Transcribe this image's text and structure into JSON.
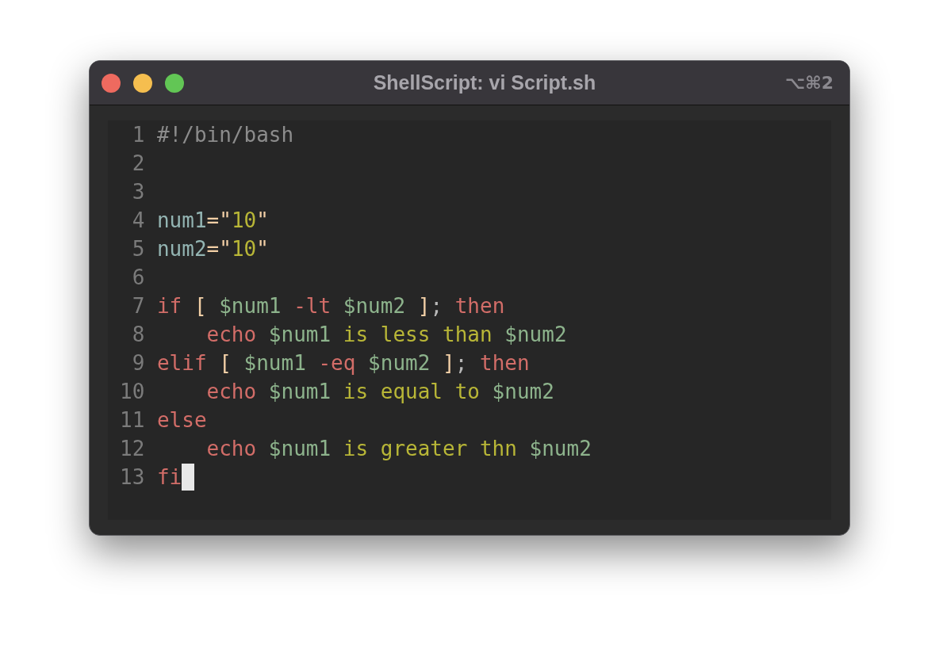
{
  "window": {
    "title": "ShellScript: vi Script.sh",
    "shortcut": "⌥⌘2"
  },
  "lines": [
    {
      "number": "1",
      "cursor": false,
      "tokens": [
        {
          "kind": "comment",
          "text": "#!/bin/bash"
        }
      ]
    },
    {
      "number": "2",
      "cursor": false
    },
    {
      "number": "3",
      "cursor": false
    },
    {
      "number": "4",
      "cursor": false,
      "tokens": [
        {
          "kind": "name",
          "text": "num1"
        },
        {
          "kind": "op",
          "text": "=\""
        },
        {
          "kind": "string",
          "text": "10"
        },
        {
          "kind": "op",
          "text": "\""
        }
      ]
    },
    {
      "number": "5",
      "cursor": false,
      "tokens": [
        {
          "kind": "name",
          "text": "num2"
        },
        {
          "kind": "op",
          "text": "=\""
        },
        {
          "kind": "string",
          "text": "10"
        },
        {
          "kind": "op",
          "text": "\""
        }
      ]
    },
    {
      "number": "6",
      "cursor": false
    },
    {
      "number": "7",
      "cursor": false,
      "tokens": [
        {
          "kind": "keyword",
          "text": "if"
        },
        {
          "kind": "op",
          "text": " [ "
        },
        {
          "kind": "variable",
          "text": "$num1"
        },
        {
          "kind": "keyword",
          "text": " -lt "
        },
        {
          "kind": "variable",
          "text": "$num2"
        },
        {
          "kind": "op",
          "text": " ]"
        },
        {
          "kind": "plain",
          "text": "; "
        },
        {
          "kind": "keyword",
          "text": "then"
        }
      ]
    },
    {
      "number": "8",
      "cursor": false,
      "tokens": [
        {
          "kind": "keyword",
          "text": "    echo "
        },
        {
          "kind": "variable",
          "text": "$num1"
        },
        {
          "kind": "string",
          "text": " is less than "
        },
        {
          "kind": "variable",
          "text": "$num2"
        }
      ]
    },
    {
      "number": "9",
      "cursor": false,
      "tokens": [
        {
          "kind": "keyword",
          "text": "elif"
        },
        {
          "kind": "op",
          "text": " [ "
        },
        {
          "kind": "variable",
          "text": "$num1"
        },
        {
          "kind": "keyword",
          "text": " -eq "
        },
        {
          "kind": "variable",
          "text": "$num2"
        },
        {
          "kind": "op",
          "text": " ]"
        },
        {
          "kind": "plain",
          "text": "; "
        },
        {
          "kind": "keyword",
          "text": "then"
        }
      ]
    },
    {
      "number": "10",
      "cursor": false,
      "tokens": [
        {
          "kind": "keyword",
          "text": "    echo "
        },
        {
          "kind": "variable",
          "text": "$num1"
        },
        {
          "kind": "string",
          "text": " is equal to "
        },
        {
          "kind": "variable",
          "text": "$num2"
        }
      ]
    },
    {
      "number": "11",
      "cursor": false,
      "tokens": [
        {
          "kind": "keyword",
          "text": "else"
        }
      ]
    },
    {
      "number": "12",
      "cursor": false,
      "tokens": [
        {
          "kind": "keyword",
          "text": "    echo "
        },
        {
          "kind": "variable",
          "text": "$num1"
        },
        {
          "kind": "string",
          "text": " is greater thn "
        },
        {
          "kind": "variable",
          "text": "$num2"
        }
      ]
    },
    {
      "number": "13",
      "cursor": true,
      "tokens": [
        {
          "kind": "keyword",
          "text": "fi"
        }
      ]
    }
  ]
}
